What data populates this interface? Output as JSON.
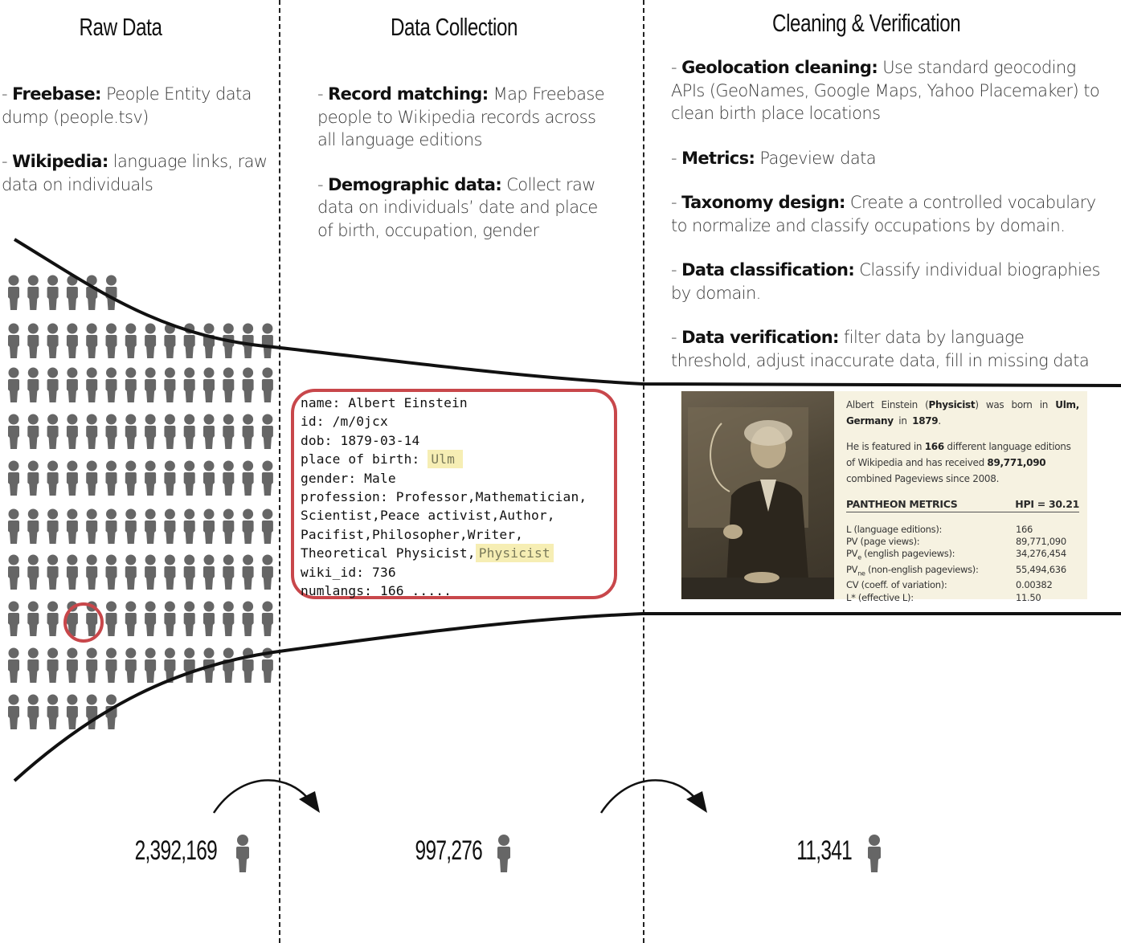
{
  "columns": [
    {
      "title": "Raw Data",
      "items": [
        {
          "label": "Freebase:",
          "text": "People Entity data dump (people.tsv)"
        },
        {
          "label": "Wikipedia:",
          "text": "language links, raw data on individuals"
        }
      ]
    },
    {
      "title": "Data Collection",
      "items": [
        {
          "label": "Record matching:",
          "text": "Map Freebase people to Wikipedia records across all language editions"
        },
        {
          "label": "Demographic data:",
          "text": "Collect raw data on individuals’ date and place of birth, occupation, gender"
        }
      ]
    },
    {
      "title": "Cleaning & Verification",
      "items": [
        {
          "label": "Geolocation cleaning:",
          "text": "Use standard geocoding APIs (GeoNames, Google Maps, Yahoo Placemaker) to clean birth place locations"
        },
        {
          "label": "Metrics:",
          "text": "Pageview data"
        },
        {
          "label": "Taxonomy design:",
          "text": "Create a controlled vocabulary to normalize and classify occupations by domain."
        },
        {
          "label": "Data classification:",
          "text": "Classify individual biographies by domain."
        },
        {
          "label": "Data verification:",
          "text": " filter data by language threshold, adjust inaccurate data, fill in missing data"
        }
      ]
    }
  ],
  "record": {
    "name_line": "name: Albert Einstein",
    "id_line": "id: /m/0jcx",
    "dob_line": "dob: 1879-03-14",
    "pob_label": "place of birth:",
    "pob_value": "Ulm",
    "gender_line": "gender: Male",
    "profession_1": "profession: Professor,Mathematician,",
    "profession_2": "Scientist,Peace activist,Author,",
    "profession_3": "Pacifist,Philosopher,Writer,",
    "profession_4a": "Theoretical Physicist,",
    "profession_4b": "Physicist",
    "wiki_line": "wiki_id: 736",
    "numlangs_line": "numlangs: 166 ....."
  },
  "card": {
    "photo_alt": "Portrait photo of Albert Einstein at a chalkboard",
    "s1_a": "Albert Einstein (",
    "s1_occ": "Physicist",
    "s1_b": ") was born in ",
    "s1_place": "Ulm, Germany",
    "s1_c": " in ",
    "s1_year": "1879",
    "s1_d": ".",
    "s2_a": "He is featured in ",
    "s2_langs": "166",
    "s2_b": " different language editions of Wikipedia and has received ",
    "s2_views": "89,771,090",
    "s2_c": " combined Pageviews since 2008.",
    "metrics_title": "PANTHEON METRICS",
    "hpi": "HPI = 30.21",
    "metrics": [
      {
        "key": "L (language editions):",
        "value": "166"
      },
      {
        "key": "PV (page views):",
        "value": "89,771,090"
      },
      {
        "key_main": "PV",
        "key_sub": "e",
        "key_rest": " (english pageviews):",
        "value": "34,276,454"
      },
      {
        "key_main": "PV",
        "key_sub": "ne",
        "key_rest": " (non-english pageviews):",
        "value": "55,494,636"
      },
      {
        "key": "CV (coeff. of variation):",
        "value": "0.00382"
      },
      {
        "key": "L* (effective L):",
        "value": "11.50"
      }
    ]
  },
  "counts": [
    "2,392,169",
    "997,276",
    "11,341"
  ],
  "colors": {
    "highlight_circle": "#c8474b",
    "record_border": "#c8474b",
    "person_icon": "#666666",
    "highlight_fill": "#f6eeb4",
    "card_bg": "#f6f2e1"
  }
}
